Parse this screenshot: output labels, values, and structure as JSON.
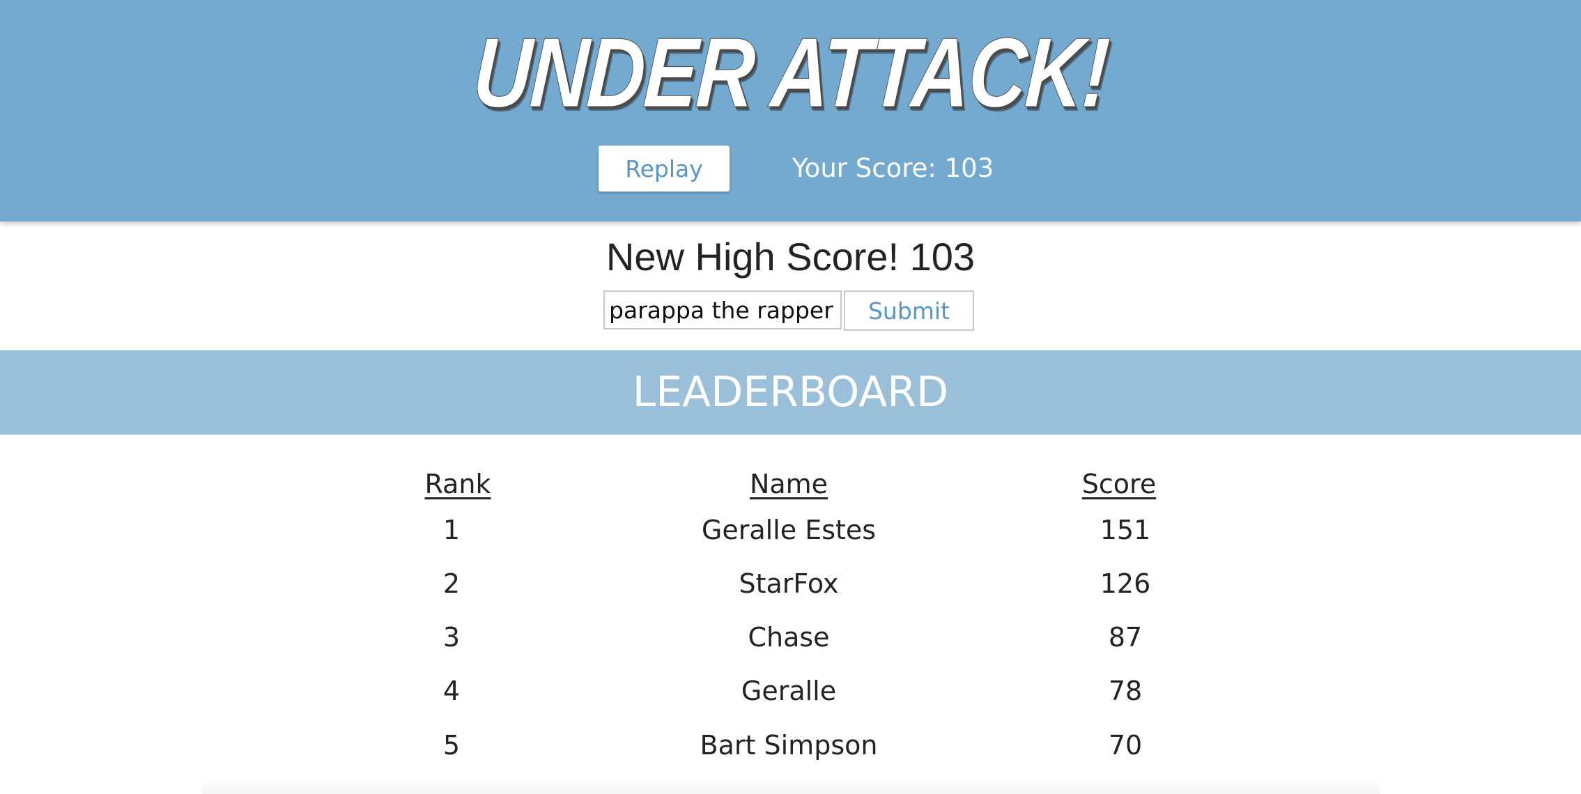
{
  "header": {
    "logo_text": "UNDER ATTACK!",
    "replay_label": "Replay",
    "score_label": "Your Score:",
    "score_value": "103"
  },
  "highscore": {
    "title": "New High Score! 103",
    "name_value": "parappa the rapper",
    "submit_label": "Submit"
  },
  "leaderboard": {
    "title": "LEADERBOARD",
    "columns": [
      "Rank",
      "Name",
      "Score"
    ],
    "rows": [
      {
        "rank": "1",
        "name": "Geralle Estes",
        "score": "151"
      },
      {
        "rank": "2",
        "name": "StarFox",
        "score": "126"
      },
      {
        "rank": "3",
        "name": "Chase",
        "score": "87"
      },
      {
        "rank": "4",
        "name": "Geralle",
        "score": "78"
      },
      {
        "rank": "5",
        "name": "Bart Simpson",
        "score": "70"
      }
    ]
  },
  "colors": {
    "header_bg": "#74aad0",
    "leaderboard_bar_bg": "#9abfd9",
    "accent_text": "#5796c6"
  }
}
